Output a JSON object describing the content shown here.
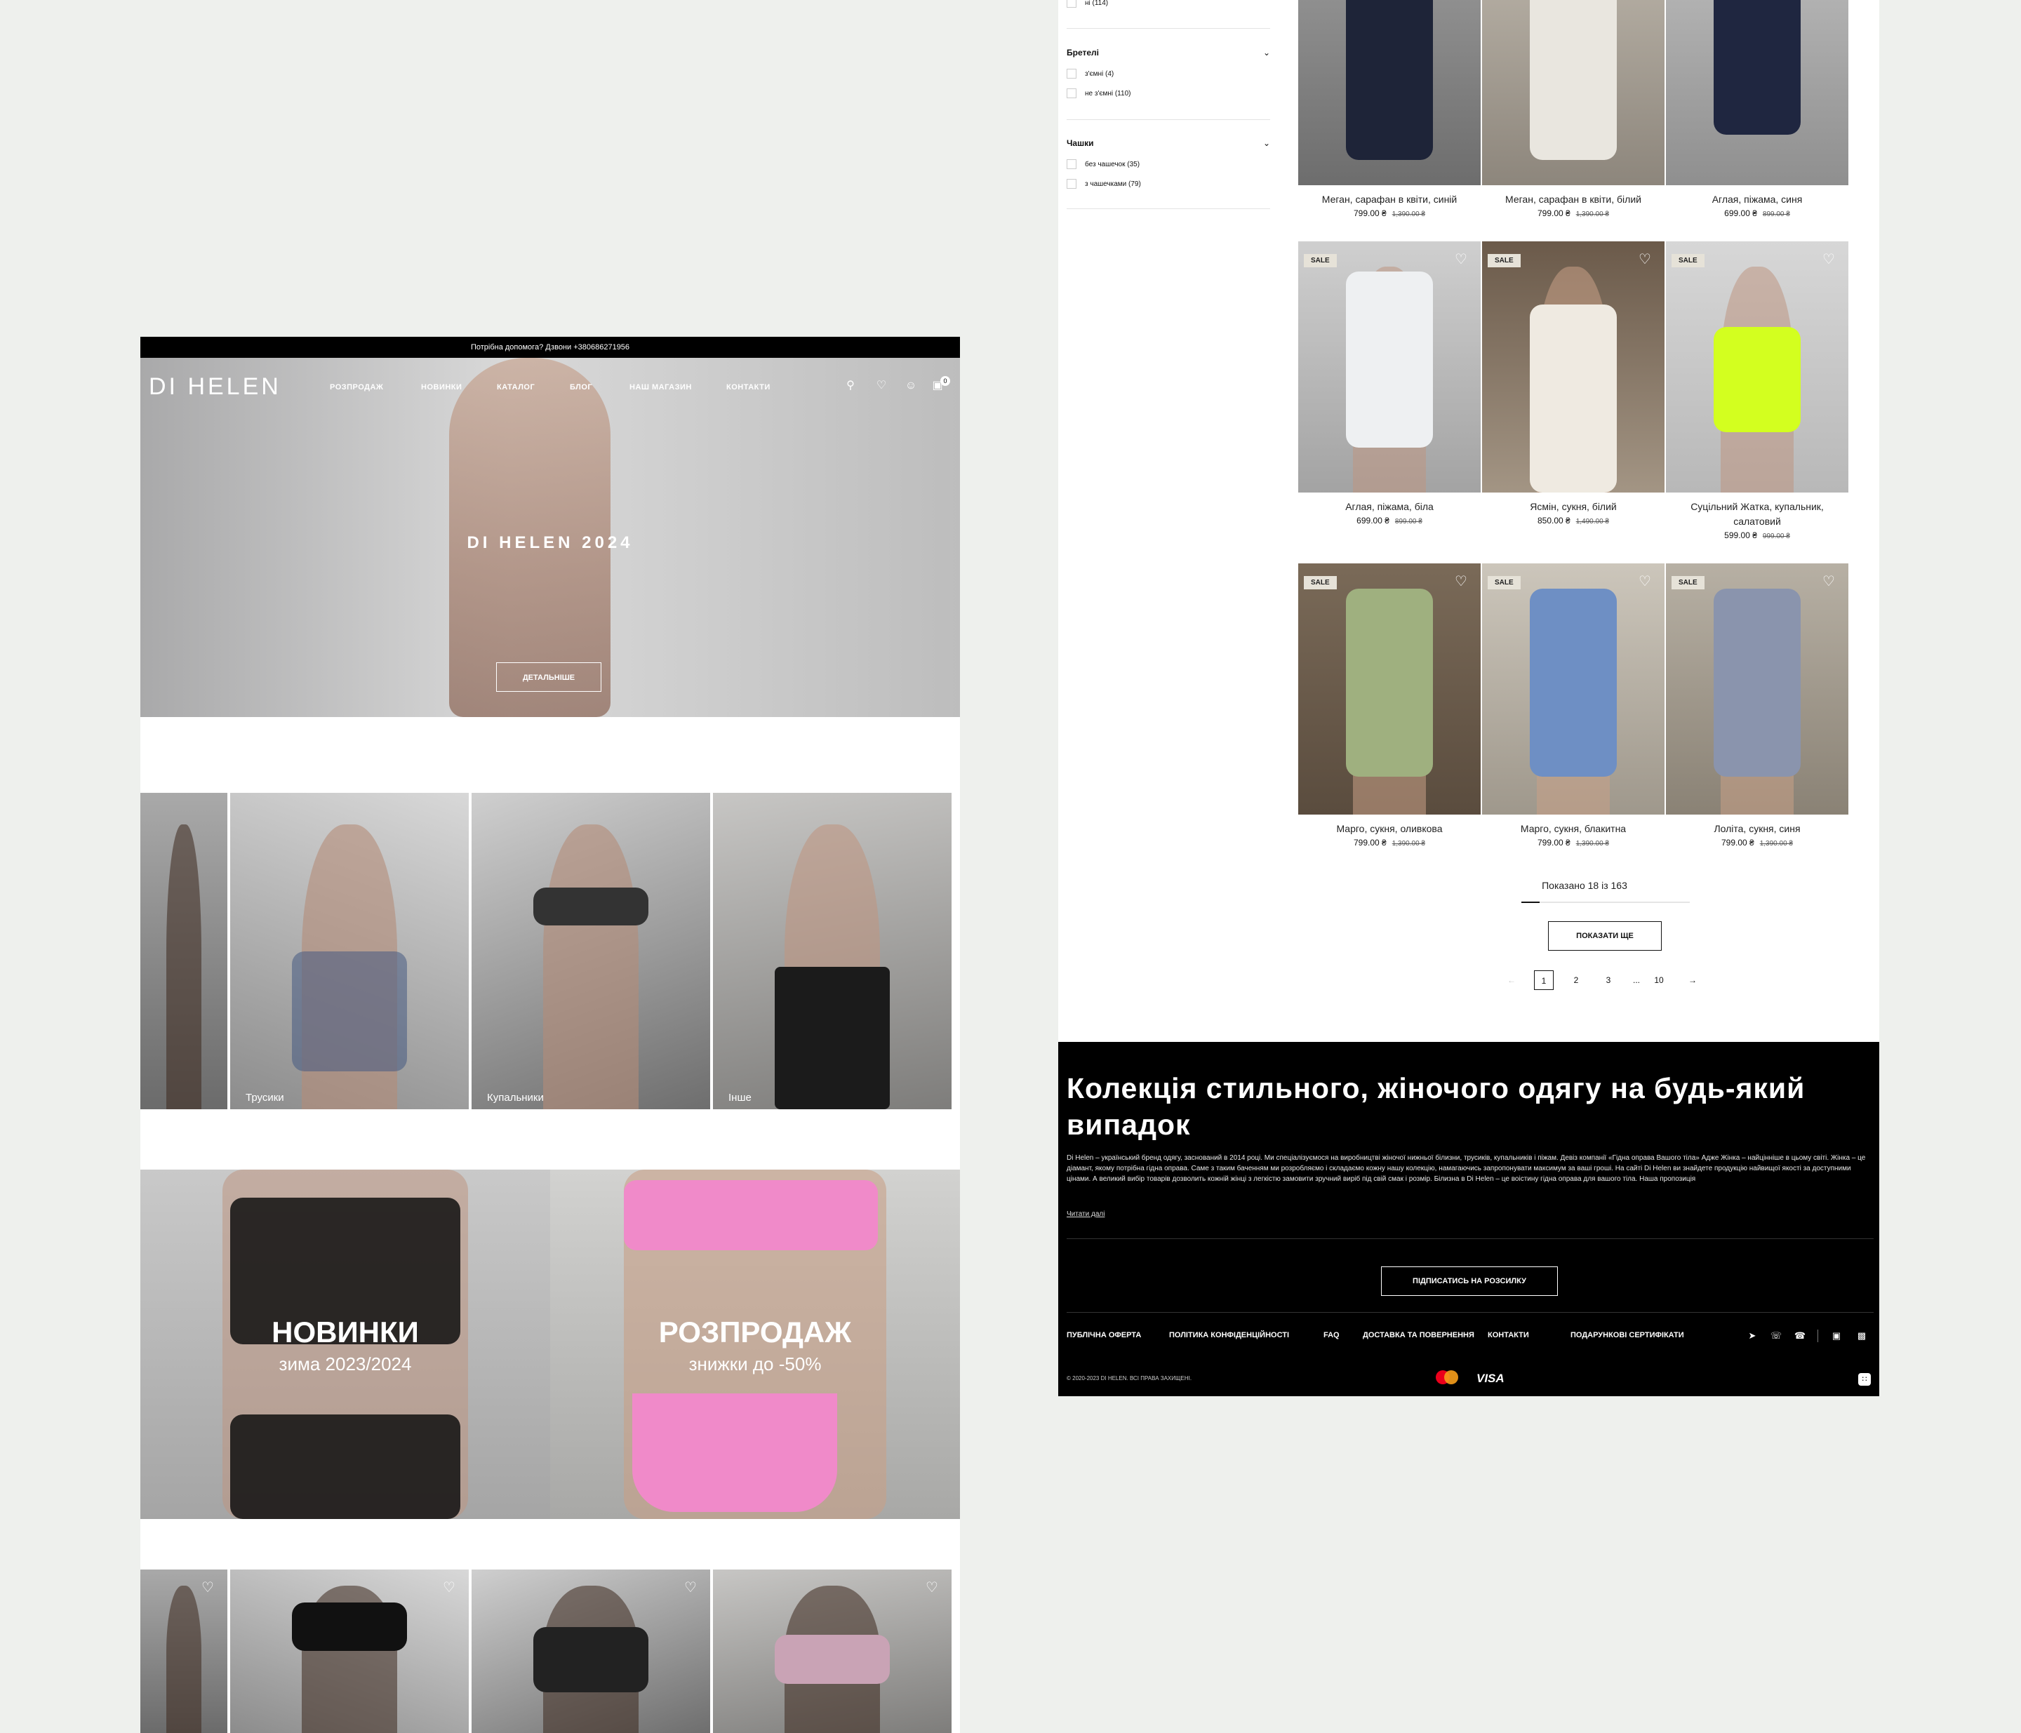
{
  "left_page": {
    "topbar_text": "Потрібна допомога? Дзвони +380686271956",
    "logo": "DI HELEN",
    "nav": [
      "РОЗПРОДАЖ",
      "НОВИНКИ",
      "КАТАЛОГ",
      "БЛОГ",
      "НАШ МАГАЗИН",
      "КОНТАКТИ"
    ],
    "cart_count": "0",
    "hero": {
      "title": "DI HELEN 2024",
      "button": "ДЕТАЛЬНІШЕ"
    },
    "categories": [
      "Трусики",
      "Купальники",
      "Інше"
    ],
    "promos": [
      {
        "title": "НОВИНКИ",
        "subtitle": "зима 2023/2024"
      },
      {
        "title": "РОЗПРОДАЖ",
        "subtitle": "знижки до -50%"
      }
    ]
  },
  "filters": {
    "top_option": "ні (114)",
    "groups": [
      {
        "title": "Бретелі",
        "options": [
          "з'ємні (4)",
          "не з'ємні (110)"
        ]
      },
      {
        "title": "Чашки",
        "options": [
          "без чашечок (35)",
          "з чашечками (79)"
        ]
      }
    ]
  },
  "products": [
    {
      "name": "Меган, сарафан в квіти, синій",
      "price": "799.00 ₴",
      "old": "1,390.00 ₴",
      "sale": ""
    },
    {
      "name": "Меган, сарафан в квіти, білий",
      "price": "799.00 ₴",
      "old": "1,390.00 ₴",
      "sale": ""
    },
    {
      "name": "Аглая, піжама, синя",
      "price": "699.00 ₴",
      "old": "899.00 ₴",
      "sale": ""
    },
    {
      "name": "Аглая, піжама, біла",
      "price": "699.00 ₴",
      "old": "899.00 ₴",
      "sale": "SALE"
    },
    {
      "name": "Ясмін, сукня, білий",
      "price": "850.00 ₴",
      "old": "1,490.00 ₴",
      "sale": "SALE"
    },
    {
      "name": "Суцільний Жатка, купальник, салатовий",
      "price": "599.00 ₴",
      "old": "999.00 ₴",
      "sale": "SALE"
    },
    {
      "name": "Марго, сукня, оливкова",
      "price": "799.00 ₴",
      "old": "1,390.00 ₴",
      "sale": "SALE"
    },
    {
      "name": "Марго, сукня, блакитна",
      "price": "799.00 ₴",
      "old": "1,390.00 ₴",
      "sale": "SALE"
    },
    {
      "name": "Лоліта, сукня, синя",
      "price": "799.00 ₴",
      "old": "1,390.00 ₴",
      "sale": "SALE"
    }
  ],
  "listing": {
    "shown_text": "Показано 18 із 163",
    "show_more": "ПОКАЗАТИ ЩЕ",
    "pages": [
      "1",
      "2",
      "3",
      "...",
      "10"
    ]
  },
  "footer": {
    "heading": "Колекція стильного, жіночого одягу на будь-який випадок",
    "body": "Di Helen – український бренд одягу, заснований в 2014 році. Ми спеціалізуємося на виробництві жіночої нижньої білизни, трусиків, купальників і піжам. Девіз компанії «Гідна оправа Вашого тіла» Адже Жінка – найцінніше в цьому світі. Жінка – це діамант, якому потрібна гідна оправа. Саме з таким баченням ми розробляємо і складаємо кожну нашу колекцію, намагаючись запропонувати максимум за ваші гроші. На сайті Di Helen ви знайдете продукцію найвищої якості за доступними цінами. А великий вибір товарів дозволить кожній жінці з легкістю замовити зручний виріб під свій смак і розмір. Білизна в Di Helen – це воістину гідна оправа для вашого тіла. Наша пропозиція",
    "read_more": "Читати далі",
    "subscribe": "ПІДПИСАТИСЬ НА РОЗСИЛКУ",
    "links": [
      "ПУБЛІЧНА ОФЕРТА",
      "ПОЛІТИКА КОНФІДЕНЦІЙНОСТІ",
      "FAQ",
      "ДОСТАВКА ТА ПОВЕРНЕННЯ",
      "КОНТАКТИ",
      "ПОДАРУНКОВІ СЕРТИФІКАТИ"
    ],
    "copyright": "© 2020-2023 DI HELEN. ВСІ ПРАВА ЗАХИЩЕНІ.",
    "visa": "VISA"
  },
  "colors": {
    "background": "#eef0ed",
    "dark": "#000000",
    "sale_badge": "#e6e2d8"
  }
}
